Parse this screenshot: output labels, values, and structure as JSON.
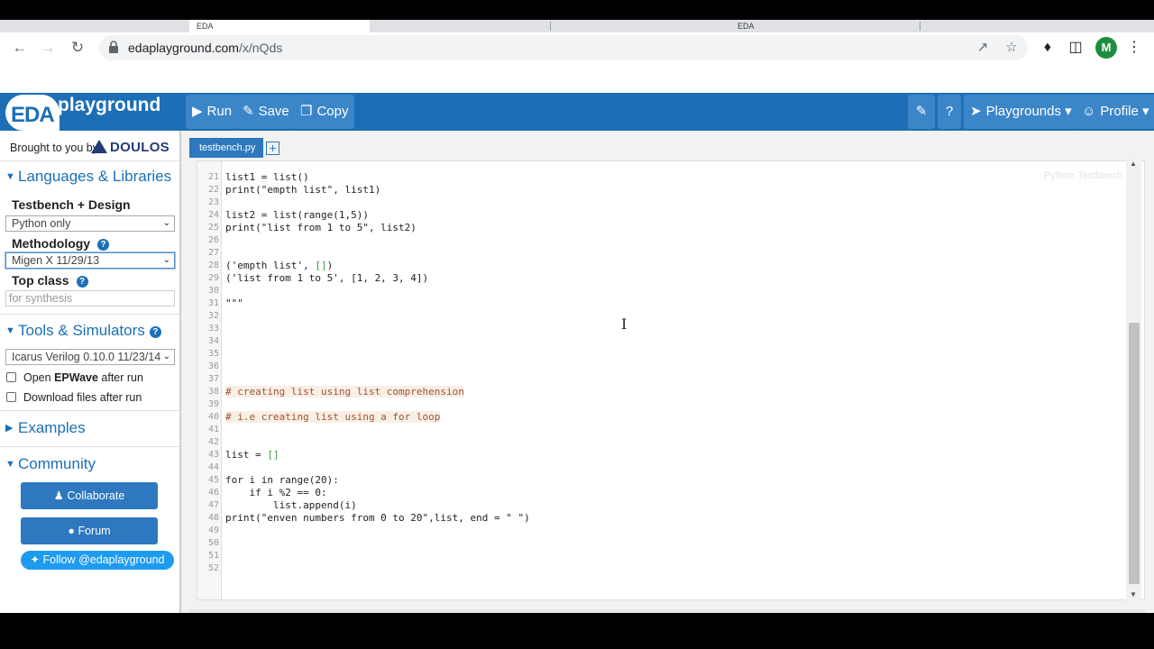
{
  "browser": {
    "tabs": [
      {
        "label": "EDA"
      },
      {
        "label": "EDA"
      }
    ],
    "url_host": "edaplayground.com",
    "url_path": "/x/nQds",
    "avatar_letter": "M"
  },
  "header": {
    "logo_eda": "EDA",
    "logo_playground": "playground",
    "run_label": "Run",
    "save_label": "Save",
    "copy_label": "Copy",
    "playgrounds_label": "Playgrounds",
    "profile_label": "Profile"
  },
  "sidebar": {
    "brought_by": "Brought to you by",
    "doulos": "DOULOS",
    "languages_heading": "Languages & Libraries",
    "testbench_label": "Testbench + Design",
    "testbench_value": "Python only",
    "methodology_label": "Methodology",
    "methodology_value": "Migen X 11/29/13",
    "topclass_label": "Top class",
    "topclass_placeholder": "for synthesis",
    "tools_heading": "Tools & Simulators",
    "simulator_value": "Icarus Verilog 0.10.0 11/23/14",
    "open_epwave_pre": "Open ",
    "open_epwave_bold": "EPWave",
    "open_epwave_post": " after run",
    "download_label": "Download files after run",
    "examples_heading": "Examples",
    "community_heading": "Community",
    "collaborate_label": "Collaborate",
    "forum_label": "Forum",
    "follow_label": "Follow @edaplayground"
  },
  "editor": {
    "file_tab": "testbench.py",
    "watermark": "Python Testbench",
    "line_numbers": [
      "21",
      "22",
      "23",
      "24",
      "25",
      "26",
      "27",
      "28",
      "29",
      "30",
      "31",
      "32",
      "33",
      "34",
      "35",
      "36",
      "37",
      "38",
      "39",
      "40",
      "41",
      "42",
      "43",
      "44",
      "45",
      "46",
      "47",
      "48",
      "49",
      "50",
      "51",
      "52"
    ],
    "lines": [
      "list1 = list()",
      "print(\"empth list\", list1)",
      "",
      "list2 = list(range(1,5))",
      "print(\"list from 1 to 5\", list2)",
      "",
      "",
      "('empth list', [])",
      "('list from 1 to 5', [1, 2, 3, 4])",
      "",
      "\"\"\"",
      "",
      "",
      "",
      "",
      "",
      "",
      "# creating list using list comprehension",
      "",
      "# i.e creating list using a for loop",
      "",
      "",
      "list = []",
      "",
      "for i in range(20):",
      "    if i %2 == 0:",
      "        list.append(i)",
      "print(\"enven numbers from 0 to 20\",list, end = \" \")",
      "",
      "",
      ""
    ]
  }
}
